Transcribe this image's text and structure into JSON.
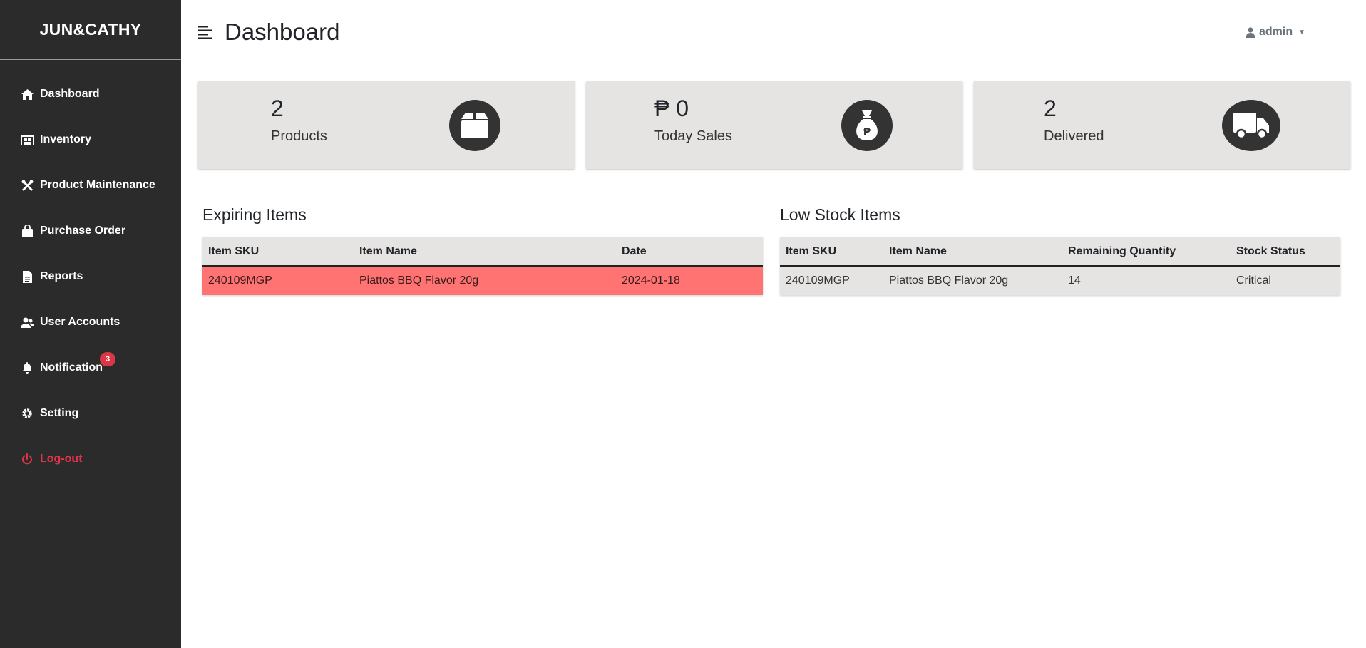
{
  "brand": "JUN&CATHY",
  "sidebar": {
    "items": [
      {
        "label": "Dashboard"
      },
      {
        "label": "Inventory"
      },
      {
        "label": "Product Maintenance"
      },
      {
        "label": "Purchase Order"
      },
      {
        "label": "Reports"
      },
      {
        "label": "User Accounts"
      },
      {
        "label": "Notification",
        "badge": "3"
      },
      {
        "label": "Setting"
      },
      {
        "label": "Log-out"
      }
    ]
  },
  "header": {
    "title": "Dashboard",
    "user": "admin"
  },
  "cards": [
    {
      "value": "2",
      "label": "Products",
      "icon": "box-icon"
    },
    {
      "value": "₱ 0",
      "label": "Today Sales",
      "icon": "money-bag-icon"
    },
    {
      "value": "2",
      "label": "Delivered",
      "icon": "truck-icon"
    }
  ],
  "expiring": {
    "title": "Expiring Items",
    "columns": [
      "Item SKU",
      "Item Name",
      "Date"
    ],
    "rows": [
      [
        "240109MGP",
        "Piattos BBQ Flavor 20g",
        "2024-01-18"
      ]
    ]
  },
  "low_stock": {
    "title": "Low Stock Items",
    "columns": [
      "Item SKU",
      "Item Name",
      "Remaining Quantity",
      "Stock Status"
    ],
    "rows": [
      [
        "240109MGP",
        "Piattos BBQ Flavor 20g",
        "14",
        "Critical"
      ]
    ]
  },
  "colors": {
    "sidebar_bg": "#2b2b2b",
    "card_bg": "#e6e4e2",
    "expiring_row": "#ff7373",
    "logout": "#e0334b",
    "badge": "#dc3545"
  }
}
